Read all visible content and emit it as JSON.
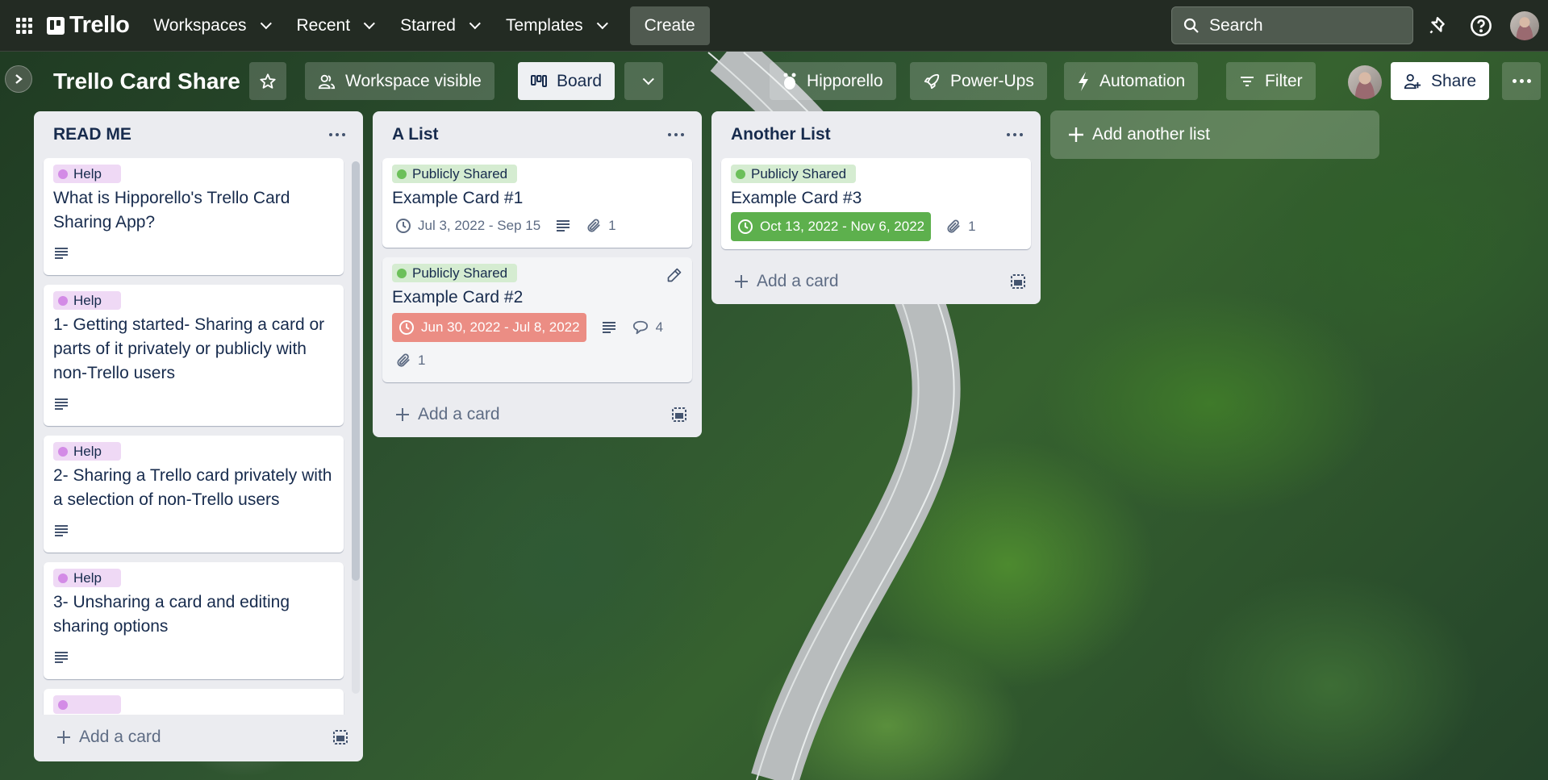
{
  "topnav": {
    "apps_icon": "grid-icon",
    "logo": "Trello",
    "menus": [
      {
        "label": "Workspaces"
      },
      {
        "label": "Recent"
      },
      {
        "label": "Starred"
      },
      {
        "label": "Templates"
      }
    ],
    "create_label": "Create",
    "search_placeholder": "Search",
    "icons": [
      "notifications-icon",
      "help-icon",
      "avatar"
    ]
  },
  "board": {
    "title": "Trello Card Share",
    "visibility_label": "Workspace visible",
    "view_label": "Board",
    "powerups": [
      {
        "label": "Hipporello",
        "icon": "hippo-icon"
      },
      {
        "label": "Power-Ups",
        "icon": "rocket-icon"
      },
      {
        "label": "Automation",
        "icon": "bolt-icon"
      }
    ],
    "filter_label": "Filter",
    "share_label": "Share"
  },
  "lists": [
    {
      "title": "READ ME",
      "add_card_label": "Add a card",
      "cards": [
        {
          "label": "Help",
          "title": "What is Hipporello's Trello Card Sharing App?",
          "has_description": true
        },
        {
          "label": "Help",
          "title": "1- Getting started- Sharing a card or parts of it privately or publicly with non-Trello users",
          "has_description": true
        },
        {
          "label": "Help",
          "title": "2- Sharing a Trello card privately with a selection of non-Trello users",
          "has_description": true
        },
        {
          "label": "Help",
          "title": "3- Unsharing a card and editing sharing options",
          "has_description": true
        }
      ]
    },
    {
      "title": "A List",
      "add_card_label": "Add a card",
      "cards": [
        {
          "label": "Publicly Shared",
          "title": "Example Card #1",
          "due": "Jul 3, 2022 - Sep 15",
          "due_status": "none",
          "has_description": true,
          "attachments": "1"
        },
        {
          "label": "Publicly Shared",
          "title": "Example Card #2",
          "due": "Jun 30, 2022 - Jul 8, 2022",
          "due_status": "overdue",
          "has_description": true,
          "comments": "4",
          "attachments": "1"
        }
      ]
    },
    {
      "title": "Another List",
      "add_card_label": "Add a card",
      "cards": [
        {
          "label": "Publicly Shared",
          "title": "Example Card #3",
          "due": "Oct 13, 2022 - Nov 6, 2022",
          "due_status": "complete",
          "attachments": "1"
        }
      ]
    }
  ],
  "add_list_label": "Add another list",
  "colors": {
    "nav_bg": "#232b23",
    "label_help": "#d38be6",
    "label_shared": "#6cc05a",
    "due_overdue": "#eb8d84",
    "due_complete": "#5db04d",
    "text": "#172b4d"
  }
}
